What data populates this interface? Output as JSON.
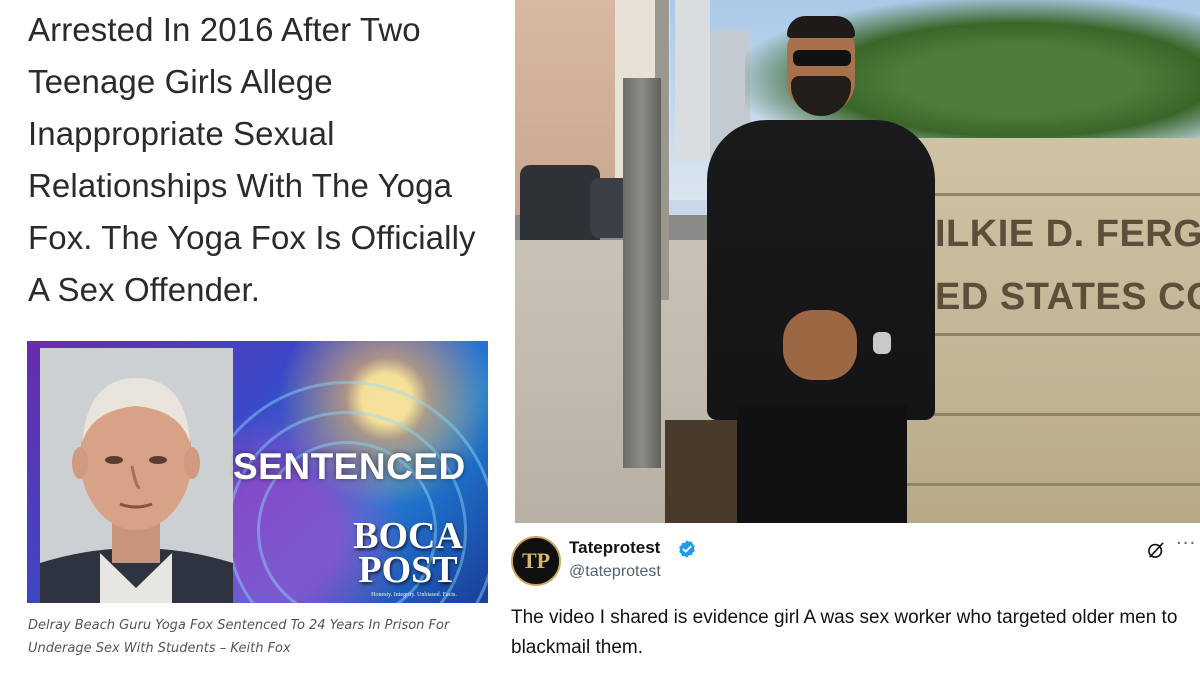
{
  "article": {
    "headline": "Arrested In 2016 After Two Teenage Girls Allege Inappropriate Sexual Relationships With The Yoga Fox. The Yoga Fox Is Officially A Sex Offender.",
    "image": {
      "overlay_text": "SENTENCED",
      "logo_line1": "BOCA",
      "logo_line2": "POST",
      "logo_tagline": "Honesty. Integrity. Unbiased. Facts."
    },
    "caption": "Delray Beach Guru Yoga Fox Sentenced To 24 Years In Prison For Underage Sex With Students – Keith Fox"
  },
  "photo": {
    "sign_line1": "ILKIE D. FERGUS",
    "sign_line2": "ED STATES COU"
  },
  "tweet": {
    "display_name": "Tateprotest",
    "handle": "@tateprotest",
    "avatar_initials": "TP",
    "verified": true,
    "verified_color": "#1d9bf0",
    "more_label": "···",
    "text": "The video I shared is evidence girl A was sex worker who targeted older men to blackmail them."
  }
}
